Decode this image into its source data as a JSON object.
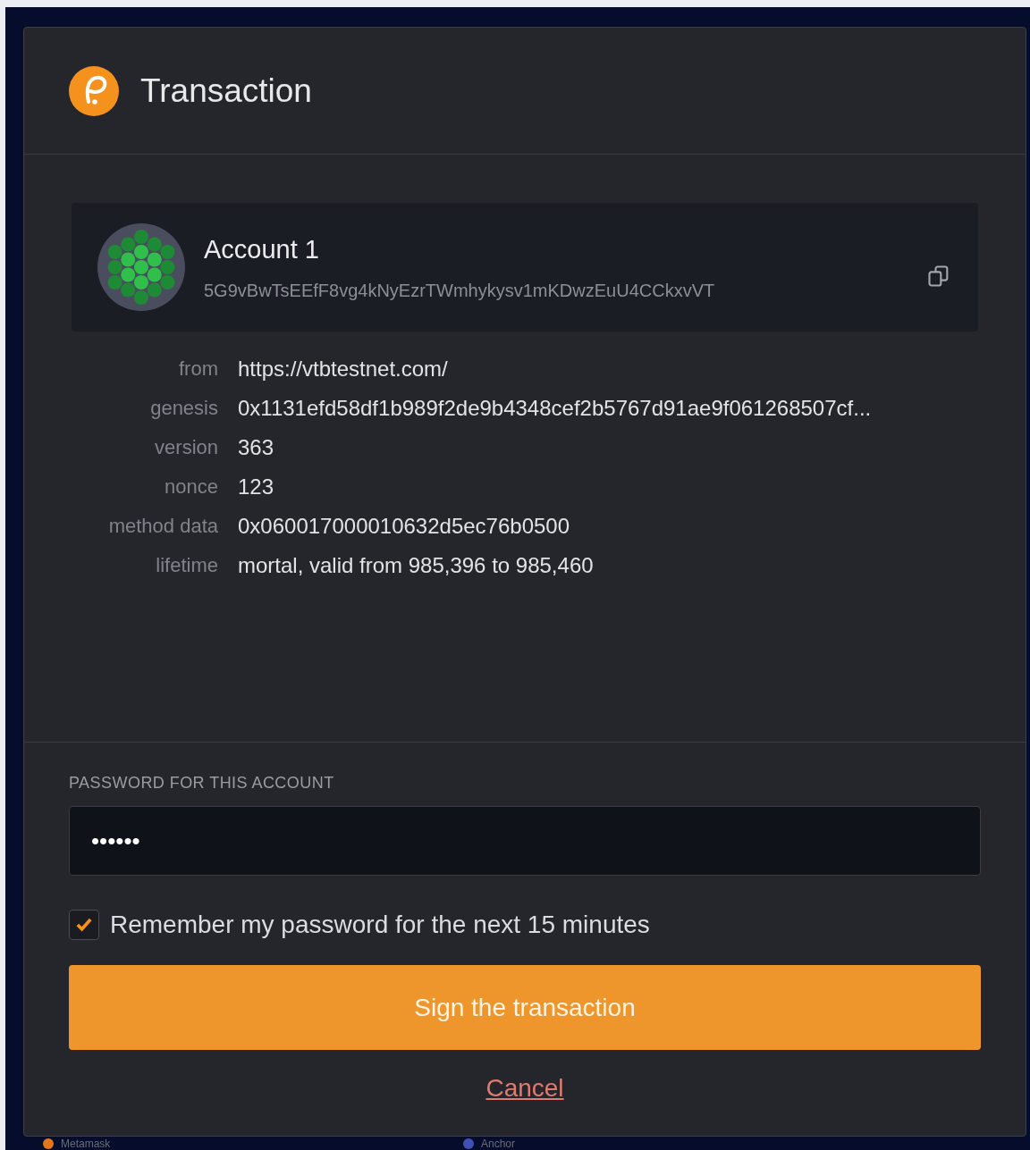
{
  "dialog": {
    "title": "Transaction"
  },
  "account": {
    "name": "Account 1",
    "address": "5G9vBwTsEEfF8vg4kNyEzrTWmhykysv1mKDwzEuU4CCkxvVT"
  },
  "details": [
    {
      "label": "from",
      "value": "https://vtbtestnet.com/"
    },
    {
      "label": "genesis",
      "value": "0x1131efd58df1b989f2de9b4348cef2b5767d91ae9f061268507cf..."
    },
    {
      "label": "version",
      "value": "363"
    },
    {
      "label": "nonce",
      "value": "123"
    },
    {
      "label": "method data",
      "value": "0x060017000010632d5ec76b0500"
    },
    {
      "label": "lifetime",
      "value": "mortal, valid from 985,396 to 985,460"
    }
  ],
  "password": {
    "label": "PASSWORD FOR THIS ACCOUNT",
    "value": "••••••"
  },
  "remember": {
    "label": "Remember my password for the next 15 minutes",
    "checked": true
  },
  "sign_button": "Sign the transaction",
  "cancel_link": "Cancel",
  "background_items": [
    "Metamask",
    "Anchor"
  ]
}
